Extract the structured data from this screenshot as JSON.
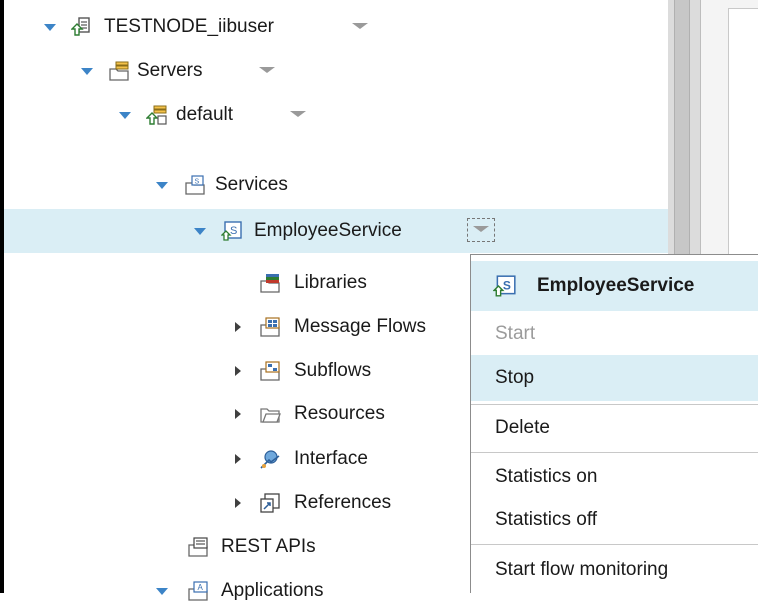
{
  "tree": {
    "nodes": [
      {
        "label": "TESTNODE_iibuser",
        "icon": "integration-node-icon"
      },
      {
        "label": "Servers",
        "icon": "servers-folder-icon"
      },
      {
        "label": "default",
        "icon": "integration-server-icon"
      },
      {
        "label": "Services",
        "icon": "services-folder-icon"
      },
      {
        "label": "EmployeeService",
        "icon": "service-icon"
      },
      {
        "label": "Libraries",
        "icon": "libraries-icon"
      },
      {
        "label": "Message Flows",
        "icon": "message-flows-icon"
      },
      {
        "label": "Subflows",
        "icon": "subflows-icon"
      },
      {
        "label": "Resources",
        "icon": "resources-folder-icon"
      },
      {
        "label": "Interface",
        "icon": "interface-icon"
      },
      {
        "label": "References",
        "icon": "references-icon"
      },
      {
        "label": "REST APIs",
        "icon": "rest-apis-icon"
      },
      {
        "label": "Applications",
        "icon": "applications-icon"
      }
    ]
  },
  "context_menu": {
    "title": "EmployeeService",
    "items": [
      {
        "label": "Start",
        "enabled": false
      },
      {
        "label": "Stop",
        "enabled": true,
        "highlighted": true
      },
      {
        "label": "Delete",
        "enabled": true
      },
      {
        "label": "Statistics on",
        "enabled": true
      },
      {
        "label": "Statistics off",
        "enabled": true
      },
      {
        "label": "Start flow monitoring",
        "enabled": true
      }
    ]
  },
  "colors": {
    "selection": "#daeef5",
    "expand_arrow": "#3c84c7",
    "disabled_text": "#9b9b9b"
  }
}
